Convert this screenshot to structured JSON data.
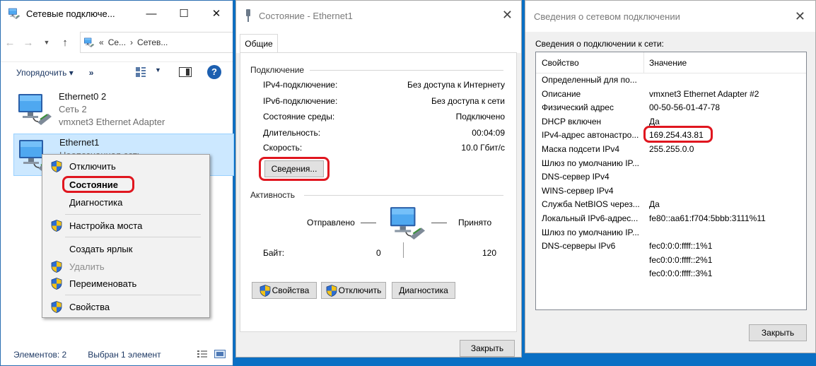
{
  "explorer": {
    "title": "Сетевые подключе...",
    "crumb_sep": "«",
    "crumb1": "Се...",
    "crumb_arrow": "›",
    "crumb2": "Сетев...",
    "sort_label": "Упорядочить ▾",
    "more_label": "»",
    "help_label": "?",
    "items": [
      {
        "name": "Ethernet0 2",
        "network": "Сеть 2",
        "adapter": "vmxnet3 Ethernet Adapter"
      },
      {
        "name": "Ethernet1",
        "network": "Неопознанная сеть",
        "adapter": ""
      }
    ],
    "status_count": "Элементов: 2",
    "status_selected": "Выбран 1 элемент"
  },
  "context_menu": {
    "items": [
      {
        "label": "Отключить",
        "shield": true,
        "disabled": false
      },
      {
        "label": "Состояние",
        "shield": false,
        "disabled": false,
        "default": true
      },
      {
        "label": "Диагностика",
        "shield": false,
        "disabled": false
      },
      {
        "label": "Настройка моста",
        "shield": true,
        "disabled": false
      },
      {
        "label": "Создать ярлык",
        "shield": false,
        "disabled": false
      },
      {
        "label": "Удалить",
        "shield": true,
        "disabled": true
      },
      {
        "label": "Переименовать",
        "shield": true,
        "disabled": false
      },
      {
        "label": "Свойства",
        "shield": true,
        "disabled": false
      }
    ]
  },
  "status_dialog": {
    "title": "Состояние - Ethernet1",
    "tab": "Общие",
    "connection_group": "Подключение",
    "rows": [
      {
        "label": "IPv4-подключение:",
        "value": "Без доступа к Интернету"
      },
      {
        "label": "IPv6-подключение:",
        "value": "Без доступа к сети"
      },
      {
        "label": "Состояние среды:",
        "value": "Подключено"
      },
      {
        "label": "Длительность:",
        "value": "00:04:09"
      },
      {
        "label": "Скорость:",
        "value": "10.0 Гбит/с"
      }
    ],
    "details_button": "Сведения...",
    "activity_group": "Активность",
    "sent_label": "Отправлено",
    "received_label": "Принято",
    "bytes_label": "Байт:",
    "bytes_sent": "0",
    "bytes_received": "120",
    "properties_button": "Свойства",
    "disable_button": "Отключить",
    "diagnose_button": "Диагностика",
    "close_button": "Закрыть"
  },
  "details_dialog": {
    "title": "Сведения о сетевом подключении",
    "label": "Сведения о подключении к сети:",
    "col_property": "Свойство",
    "col_value": "Значение",
    "rows": [
      {
        "p": "Определенный для по...",
        "v": ""
      },
      {
        "p": "Описание",
        "v": "vmxnet3 Ethernet Adapter #2"
      },
      {
        "p": "Физический адрес",
        "v": "00-50-56-01-47-78"
      },
      {
        "p": "DHCP включен",
        "v": "Да"
      },
      {
        "p": "IPv4-адрес автонастро...",
        "v": "169.254.43.81"
      },
      {
        "p": "Маска подсети IPv4",
        "v": "255.255.0.0"
      },
      {
        "p": "Шлюз по умолчанию IP...",
        "v": ""
      },
      {
        "p": "DNS-сервер IPv4",
        "v": ""
      },
      {
        "p": "WINS-сервер IPv4",
        "v": ""
      },
      {
        "p": "Служба NetBIOS через...",
        "v": "Да"
      },
      {
        "p": "Локальный IPv6-адрес...",
        "v": "fe80::aa61:f704:5bbb:3111%11"
      },
      {
        "p": "Шлюз по умолчанию IP...",
        "v": ""
      },
      {
        "p": "DNS-серверы IPv6",
        "v": "fec0:0:0:ffff::1%1"
      },
      {
        "p": "",
        "v": "fec0:0:0:ffff::2%1"
      },
      {
        "p": "",
        "v": "fec0:0:0:ffff::3%1"
      }
    ],
    "close_button": "Закрыть"
  },
  "colors": {
    "desktop": "#0a6fc4",
    "highlight": "#e0161f",
    "selection": "#cce8ff"
  }
}
